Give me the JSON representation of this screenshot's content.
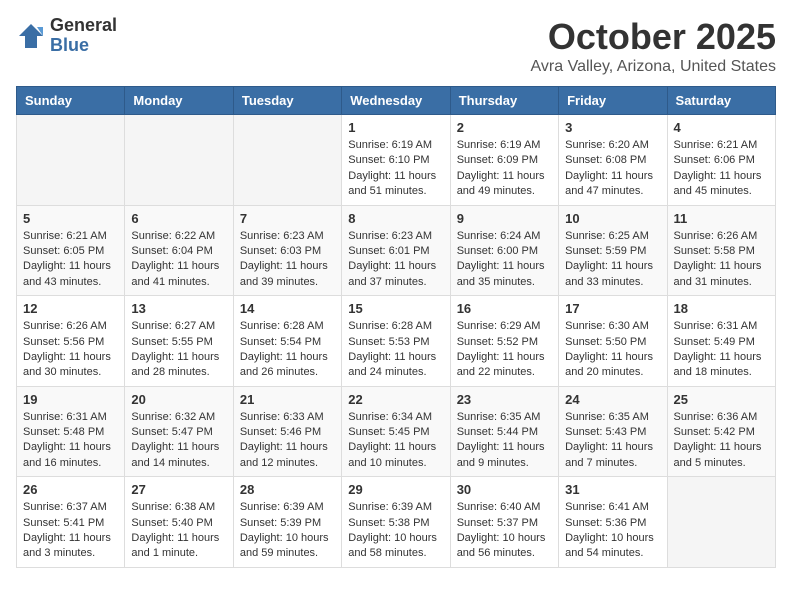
{
  "header": {
    "logo_general": "General",
    "logo_blue": "Blue",
    "month_title": "October 2025",
    "location": "Avra Valley, Arizona, United States"
  },
  "weekdays": [
    "Sunday",
    "Monday",
    "Tuesday",
    "Wednesday",
    "Thursday",
    "Friday",
    "Saturday"
  ],
  "weeks": [
    [
      {
        "day": "",
        "info": ""
      },
      {
        "day": "",
        "info": ""
      },
      {
        "day": "",
        "info": ""
      },
      {
        "day": "1",
        "info": "Sunrise: 6:19 AM\nSunset: 6:10 PM\nDaylight: 11 hours and 51 minutes."
      },
      {
        "day": "2",
        "info": "Sunrise: 6:19 AM\nSunset: 6:09 PM\nDaylight: 11 hours and 49 minutes."
      },
      {
        "day": "3",
        "info": "Sunrise: 6:20 AM\nSunset: 6:08 PM\nDaylight: 11 hours and 47 minutes."
      },
      {
        "day": "4",
        "info": "Sunrise: 6:21 AM\nSunset: 6:06 PM\nDaylight: 11 hours and 45 minutes."
      }
    ],
    [
      {
        "day": "5",
        "info": "Sunrise: 6:21 AM\nSunset: 6:05 PM\nDaylight: 11 hours and 43 minutes."
      },
      {
        "day": "6",
        "info": "Sunrise: 6:22 AM\nSunset: 6:04 PM\nDaylight: 11 hours and 41 minutes."
      },
      {
        "day": "7",
        "info": "Sunrise: 6:23 AM\nSunset: 6:03 PM\nDaylight: 11 hours and 39 minutes."
      },
      {
        "day": "8",
        "info": "Sunrise: 6:23 AM\nSunset: 6:01 PM\nDaylight: 11 hours and 37 minutes."
      },
      {
        "day": "9",
        "info": "Sunrise: 6:24 AM\nSunset: 6:00 PM\nDaylight: 11 hours and 35 minutes."
      },
      {
        "day": "10",
        "info": "Sunrise: 6:25 AM\nSunset: 5:59 PM\nDaylight: 11 hours and 33 minutes."
      },
      {
        "day": "11",
        "info": "Sunrise: 6:26 AM\nSunset: 5:58 PM\nDaylight: 11 hours and 31 minutes."
      }
    ],
    [
      {
        "day": "12",
        "info": "Sunrise: 6:26 AM\nSunset: 5:56 PM\nDaylight: 11 hours and 30 minutes."
      },
      {
        "day": "13",
        "info": "Sunrise: 6:27 AM\nSunset: 5:55 PM\nDaylight: 11 hours and 28 minutes."
      },
      {
        "day": "14",
        "info": "Sunrise: 6:28 AM\nSunset: 5:54 PM\nDaylight: 11 hours and 26 minutes."
      },
      {
        "day": "15",
        "info": "Sunrise: 6:28 AM\nSunset: 5:53 PM\nDaylight: 11 hours and 24 minutes."
      },
      {
        "day": "16",
        "info": "Sunrise: 6:29 AM\nSunset: 5:52 PM\nDaylight: 11 hours and 22 minutes."
      },
      {
        "day": "17",
        "info": "Sunrise: 6:30 AM\nSunset: 5:50 PM\nDaylight: 11 hours and 20 minutes."
      },
      {
        "day": "18",
        "info": "Sunrise: 6:31 AM\nSunset: 5:49 PM\nDaylight: 11 hours and 18 minutes."
      }
    ],
    [
      {
        "day": "19",
        "info": "Sunrise: 6:31 AM\nSunset: 5:48 PM\nDaylight: 11 hours and 16 minutes."
      },
      {
        "day": "20",
        "info": "Sunrise: 6:32 AM\nSunset: 5:47 PM\nDaylight: 11 hours and 14 minutes."
      },
      {
        "day": "21",
        "info": "Sunrise: 6:33 AM\nSunset: 5:46 PM\nDaylight: 11 hours and 12 minutes."
      },
      {
        "day": "22",
        "info": "Sunrise: 6:34 AM\nSunset: 5:45 PM\nDaylight: 11 hours and 10 minutes."
      },
      {
        "day": "23",
        "info": "Sunrise: 6:35 AM\nSunset: 5:44 PM\nDaylight: 11 hours and 9 minutes."
      },
      {
        "day": "24",
        "info": "Sunrise: 6:35 AM\nSunset: 5:43 PM\nDaylight: 11 hours and 7 minutes."
      },
      {
        "day": "25",
        "info": "Sunrise: 6:36 AM\nSunset: 5:42 PM\nDaylight: 11 hours and 5 minutes."
      }
    ],
    [
      {
        "day": "26",
        "info": "Sunrise: 6:37 AM\nSunset: 5:41 PM\nDaylight: 11 hours and 3 minutes."
      },
      {
        "day": "27",
        "info": "Sunrise: 6:38 AM\nSunset: 5:40 PM\nDaylight: 11 hours and 1 minute."
      },
      {
        "day": "28",
        "info": "Sunrise: 6:39 AM\nSunset: 5:39 PM\nDaylight: 10 hours and 59 minutes."
      },
      {
        "day": "29",
        "info": "Sunrise: 6:39 AM\nSunset: 5:38 PM\nDaylight: 10 hours and 58 minutes."
      },
      {
        "day": "30",
        "info": "Sunrise: 6:40 AM\nSunset: 5:37 PM\nDaylight: 10 hours and 56 minutes."
      },
      {
        "day": "31",
        "info": "Sunrise: 6:41 AM\nSunset: 5:36 PM\nDaylight: 10 hours and 54 minutes."
      },
      {
        "day": "",
        "info": ""
      }
    ]
  ]
}
